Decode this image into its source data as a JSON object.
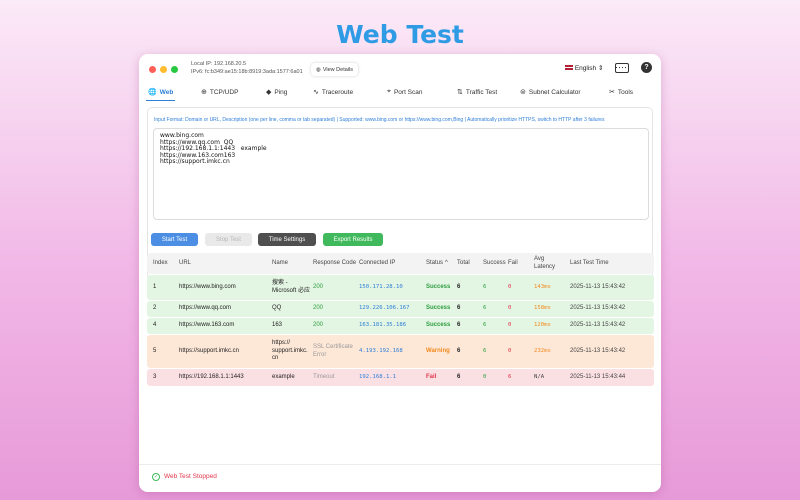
{
  "hero_title": "Web Test",
  "window": {
    "local_ip": "Local IP: 192.168.20.5",
    "ipv6": "IPv6: fc:b349:ae15:18b:8919:3ada:1577:6a01",
    "view_details": "View Details",
    "language": "English",
    "help_glyph": "?"
  },
  "tabs": [
    {
      "label": "Web",
      "icon": "globe-icon",
      "glyph": "🌐",
      "active": true
    },
    {
      "label": "TCP/UDP",
      "icon": "network-icon",
      "glyph": "⊕",
      "active": false
    },
    {
      "label": "Ping",
      "icon": "ping-icon",
      "glyph": "◆",
      "active": false
    },
    {
      "label": "Traceroute",
      "icon": "route-icon",
      "glyph": "∿",
      "active": false
    },
    {
      "label": "Port Scan",
      "icon": "port-icon",
      "glyph": "⌖",
      "active": false
    },
    {
      "label": "Traffic Test",
      "icon": "traffic-icon",
      "glyph": "⇅",
      "active": false
    },
    {
      "label": "Subnet Calculator",
      "icon": "subnet-icon",
      "glyph": "⊜",
      "active": false
    },
    {
      "label": "Tools",
      "icon": "tools-icon",
      "glyph": "✂",
      "active": false
    }
  ],
  "input": {
    "hint": "Input Format: Domain or URL, Description (one per line, comma or tab separated) | Supported: www.bing.com or https://www.bing.com,Bing | Automatically prioritize HTTPS, switch to HTTP after 3 failures",
    "lines": [
      "www.bing.com",
      "https://www.qq.com  QQ",
      "https://192.168.1.1:1443   example",
      "https://www.163.com163",
      "https://support.imkc.cn"
    ]
  },
  "buttons": {
    "start": "Start Test",
    "stop": "Stop Test",
    "time_settings": "Time Settings",
    "export": "Export Results"
  },
  "table": {
    "headers": {
      "index": "Index",
      "url": "URL",
      "name": "Name",
      "response_code": "Response Code",
      "connected_ip": "Connected IP",
      "status": "Status",
      "status_sort_glyph": "^",
      "total": "Total",
      "success": "Success",
      "fail": "Fail",
      "avg_latency": "Avg Latency",
      "last_test_time": "Last Test Time"
    },
    "rows": [
      {
        "index": "1",
        "url": "https://www.bing.com",
        "name": "搜索 - Microsoft 必应",
        "code": "200",
        "ip": "150.171.28.10",
        "status": "Success",
        "total": "6",
        "success": "6",
        "fail": "0",
        "latency": "143ms",
        "time": "2025-11-13 15:43:42",
        "kind": "success"
      },
      {
        "index": "2",
        "url": "https://www.qq.com",
        "name": "QQ",
        "code": "200",
        "ip": "129.226.106.167",
        "status": "Success",
        "total": "6",
        "success": "6",
        "fail": "0",
        "latency": "158ms",
        "time": "2025-11-13 15:43:42",
        "kind": "success"
      },
      {
        "index": "4",
        "url": "https://www.163.com",
        "name": "163",
        "code": "200",
        "ip": "163.181.35.186",
        "status": "Success",
        "total": "6",
        "success": "6",
        "fail": "0",
        "latency": "120ms",
        "time": "2025-11-13 15:43:42",
        "kind": "success"
      },
      {
        "index": "5",
        "url": "https://support.imkc.cn",
        "name": "https:// support.imkc. cn",
        "code": "SSL Certificate Error",
        "ip": "4.193.192.168",
        "status": "Warning",
        "total": "6",
        "success": "6",
        "fail": "0",
        "latency": "232ms",
        "time": "2025-11-13 15:43:42",
        "kind": "warning"
      },
      {
        "index": "3",
        "url": "https://192.168.1.1:1443",
        "name": "example",
        "code": "Timeout",
        "ip": "192.168.1.1",
        "status": "Fail",
        "total": "6",
        "success": "0",
        "fail": "6",
        "latency": "N/A",
        "time": "2025-11-13 15:43:44",
        "kind": "fail"
      }
    ]
  },
  "statusbar": {
    "text": "Web Test Stopped"
  },
  "colors": {
    "accent": "#2e7fd8",
    "success_bg": "#e3f5e3",
    "warning_bg": "#fde7d7",
    "fail_bg": "#fbe0e3",
    "success_text": "#2e9e3f",
    "warning_text": "#f28a1f",
    "fail_text": "#e0374a",
    "ip_text": "#2e7fd8"
  }
}
